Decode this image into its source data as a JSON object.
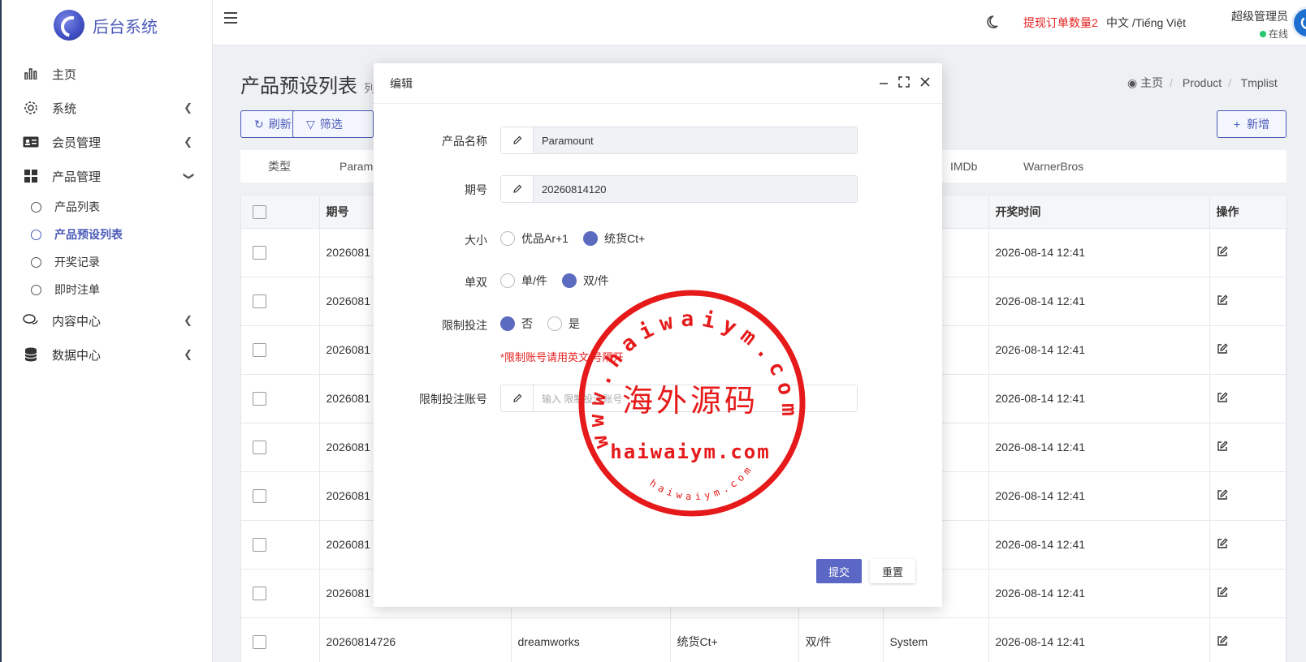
{
  "brand": {
    "name": "后台系统"
  },
  "sidebar": {
    "items": [
      {
        "label": "主页"
      },
      {
        "label": "系统"
      },
      {
        "label": "会员管理"
      },
      {
        "label": "产品管理"
      },
      {
        "label": "内容中心"
      },
      {
        "label": "数据中心"
      }
    ],
    "product_sub": [
      {
        "label": "产品列表"
      },
      {
        "label": "产品预设列表"
      },
      {
        "label": "开奖记录"
      },
      {
        "label": "即时注单"
      }
    ]
  },
  "header": {
    "alert": "提现订单数量2",
    "language": "中文 /Tiếng Việt",
    "user_name": "超级管理员",
    "user_status": "在线"
  },
  "page": {
    "title": "产品预设列表",
    "subtitle": "列",
    "breadcrumb": [
      "主页",
      "Product",
      "Tmplist"
    ]
  },
  "toolbar": {
    "refresh": "刷新",
    "filter": "筛选",
    "add": "新增"
  },
  "filter_tabs": [
    "类型",
    "Param",
    "IMDb",
    "WarnerBros"
  ],
  "table": {
    "headers": [
      "期号",
      "开奖时间",
      "操作"
    ],
    "rows": [
      {
        "period": "2026081",
        "name": "",
        "size": "",
        "parity": "",
        "source": "",
        "time": "2026-08-14 12:41"
      },
      {
        "period": "2026081",
        "name": "",
        "size": "",
        "parity": "",
        "source": "",
        "time": "2026-08-14 12:41"
      },
      {
        "period": "2026081",
        "name": "",
        "size": "",
        "parity": "",
        "source": "",
        "time": "2026-08-14 12:41"
      },
      {
        "period": "2026081",
        "name": "",
        "size": "",
        "parity": "",
        "source": "",
        "time": "2026-08-14 12:41"
      },
      {
        "period": "2026081",
        "name": "",
        "size": "",
        "parity": "",
        "source": "",
        "time": "2026-08-14 12:41"
      },
      {
        "period": "2026081",
        "name": "",
        "size": "",
        "parity": "",
        "source": "",
        "time": "2026-08-14 12:41"
      },
      {
        "period": "2026081",
        "name": "",
        "size": "",
        "parity": "",
        "source": "",
        "time": "2026-08-14 12:41"
      },
      {
        "period": "2026081",
        "name": "",
        "size": "",
        "parity": "",
        "source": "",
        "time": "2026-08-14 12:41"
      },
      {
        "period": "20260814726",
        "name": "dreamworks",
        "size": "统货Ct+",
        "parity": "双/件",
        "source": "System",
        "time": "2026-08-14 12:41"
      }
    ]
  },
  "modal": {
    "title": "编辑",
    "product_name_label": "产品名称",
    "product_name_value": "Paramount",
    "period_label": "期号",
    "period_value": "20260814120",
    "size_label": "大小",
    "size_options": [
      "优品Ar+1",
      "统货Ct+"
    ],
    "size_selected": 1,
    "parity_label": "单双",
    "parity_options": [
      "单/件",
      "双/件"
    ],
    "parity_selected": 1,
    "limit_label": "限制投注",
    "limit_options": [
      "否",
      "是"
    ],
    "limit_selected": 0,
    "hint": "*限制账号请用英文,号隔开",
    "limit_accounts_label": "限制投注账号",
    "limit_accounts_placeholder": "输入 限制投注账号",
    "submit": "提交",
    "reset": "重置"
  },
  "watermark": {
    "center_text": "海外源码",
    "ring_text": "www.haiwaiym.com",
    "lower_text": "haiwaiym.com",
    "small_text": "haiwaiym.com"
  },
  "colors": {
    "accent": "#4b5ab8",
    "alert": "#e52020",
    "stamp": "#e61a1a",
    "online": "#28c76f"
  }
}
